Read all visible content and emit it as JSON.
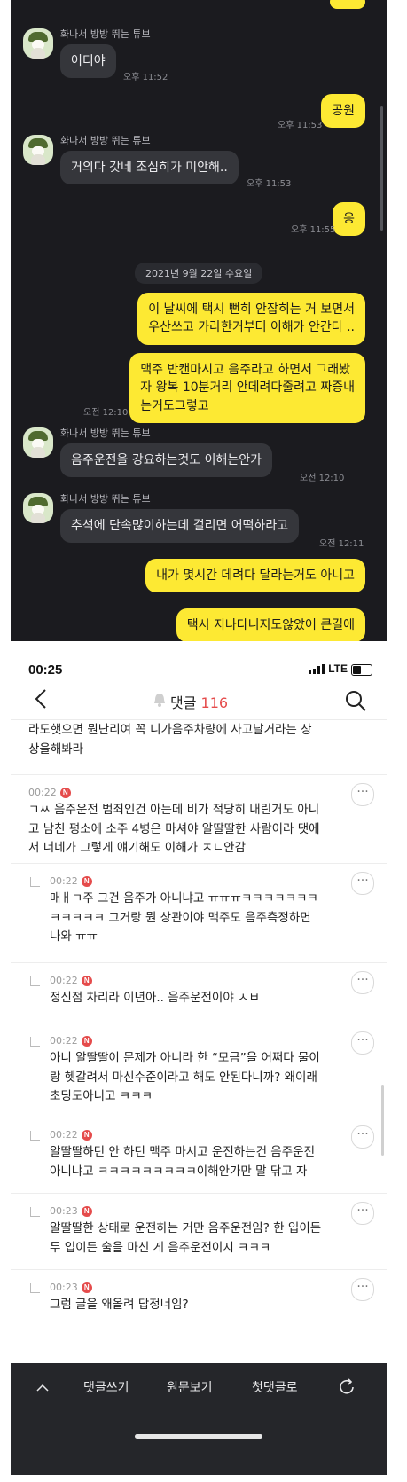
{
  "chat": {
    "messages": [
      {
        "type": "in",
        "sender": "화나서 방방 뛰는 튜브",
        "text": "어디야",
        "time": "오후 11:52"
      },
      {
        "type": "out",
        "text": "공원",
        "time": "오후 11:53"
      },
      {
        "type": "in",
        "sender": "화나서 방방 뛰는 튜브",
        "text": "거의다 갓네 조심히가 미안해..",
        "time": "오후 11:53"
      },
      {
        "type": "out",
        "text": "응",
        "time": "오후 11:55"
      },
      {
        "type": "date",
        "text": "2021년 9월 22일 수요일"
      },
      {
        "type": "out",
        "text": "이 날씨에 택시 뻔히 안잡히는 거 보면서\n우산쓰고 가라한거부터 이해가 안간다 ..",
        "time": ""
      },
      {
        "type": "out",
        "text": "맥주 반캔마시고 음주라고 하면서 그래봤\n자 왕복 10분거리 안데려다줄려고 짜증내\n는거도그렇고",
        "time": "오전 12:10"
      },
      {
        "type": "in",
        "sender": "화나서 방방 뛰는 튜브",
        "text": "음주운전을 강요하는것도 이해는안가",
        "time": "오전 12:10"
      },
      {
        "type": "in",
        "sender": "화나서 방방 뛰는 튜브",
        "text": "추석에 단속많이하는데 걸리면 어떡하라고",
        "time": "오전 12:11"
      },
      {
        "type": "out",
        "text": "내가 몇시간 데려다 달라는거도 아니고",
        "time": ""
      },
      {
        "type": "out",
        "text": "택시 지나다니지도않았어 큰길에",
        "time": ""
      }
    ]
  },
  "status_bar": {
    "time": "00:25",
    "network": "LTE"
  },
  "nav": {
    "title": "댓글",
    "count": "116"
  },
  "comments": [
    {
      "id": "c0",
      "reply": false,
      "meta": "",
      "text": "라도햇으면 뭔난리여 꼭 니가음주차량에 사고날거라는 상\n상을해봐라"
    },
    {
      "id": "c1",
      "reply": false,
      "meta": "00:22",
      "text": "ㄱㅆ 음주운전 범죄인건 아는데 비가 적당히 내린거도 아니\n고 남친 평소에 소주 4병은 마셔야 알딸딸한 사람이라 댓에\n서 너네가 그렇게 얘기해도 이해가 ㅈㄴ안감"
    },
    {
      "id": "c2",
      "reply": true,
      "meta": "00:22",
      "text": "매ㅐㄱ주 그건 음주가 아니냐고 ㅠㅠㅠㅋㅋㅋㅋㅋㅋㅋ\nㅋㅋㅋㅋㅋ 그거랑 뭔 상관이야 맥주도 음주측정하면\n나와 ㅠㅠ"
    },
    {
      "id": "c3",
      "reply": true,
      "meta": "00:22",
      "text": "정신점 차리라 이년아.. 음주운전이야 ㅅㅂ"
    },
    {
      "id": "c4",
      "reply": true,
      "meta": "00:22",
      "text": "아니 알딸딸이 문제가 아니라 한 “모금”을 어쩌다 물이\n랑 헷갈려서 마신수준이라고 해도 안된다니까? 왜이래\n초딩도아니고 ㅋㅋㅋ"
    },
    {
      "id": "c5",
      "reply": true,
      "meta": "00:22",
      "text": "알딸딸하던 안 하던 맥주 마시고 운전하는건 음주운전\n아니냐고 ㅋㅋㅋㅋㅋㅋㅋㅋㅋ이해안가만 말 닦고 자"
    },
    {
      "id": "c6",
      "reply": true,
      "meta": "00:23",
      "text": "알딸딸한 상태로 운전하는 거만 음주운전임? 한 입이든\n두 입이든 술을 마신 게 음주운전이지 ㅋㅋㅋ"
    },
    {
      "id": "c7",
      "reply": true,
      "meta": "00:23",
      "text": "그럼 글을 왜올려 답정너임?"
    }
  ],
  "badge": "N",
  "more_label": "···",
  "toolbar": {
    "up": "^",
    "write": "댓글쓰기",
    "original": "원문보기",
    "first": "첫댓글로"
  },
  "colors": {
    "kakao_yellow": "#fde933",
    "chat_bg": "#1b1b1f",
    "count_red": "#e54b4b",
    "toolbar_bg": "#25262a"
  }
}
